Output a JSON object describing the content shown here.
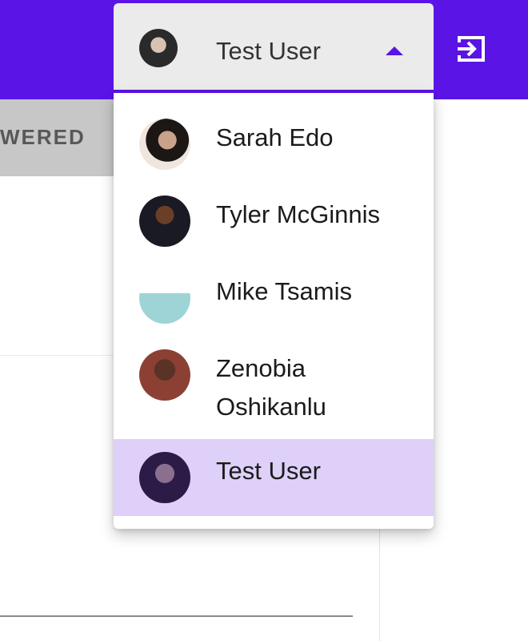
{
  "tab": {
    "label": "WERED"
  },
  "user_select": {
    "selected": "Test User",
    "options": [
      {
        "name": "Sarah Edo"
      },
      {
        "name": "Tyler McGinnis"
      },
      {
        "name": "Mike Tsamis"
      },
      {
        "name": "Zenobia Oshikanlu"
      },
      {
        "name": "Test User"
      }
    ]
  },
  "colors": {
    "accent": "#5a14e6",
    "selected_bg": "#ded0f8"
  },
  "icons": {
    "logout": "logout-icon",
    "caret": "caret-up-icon"
  }
}
